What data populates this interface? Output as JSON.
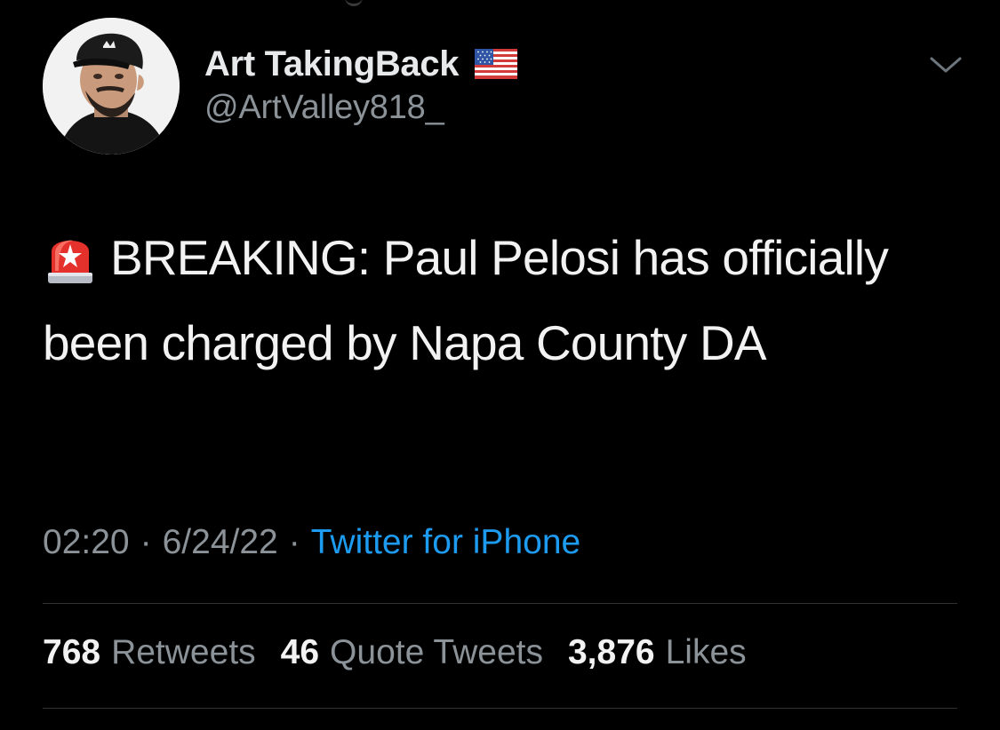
{
  "author": {
    "display_name": "Art TakingBack",
    "handle": "@ArtValley818_",
    "flag_icon": "us-flag-icon",
    "avatar_icon": "profile-avatar"
  },
  "menu": {
    "caret_icon": "chevron-down-icon"
  },
  "tweet": {
    "emoji_icon": "police-siren-icon",
    "text": "BREAKING: Paul Pelosi has officially been charged by Napa County DA"
  },
  "meta": {
    "time": "02:20",
    "date": "6/24/22",
    "separator": "·",
    "source": "Twitter for iPhone"
  },
  "stats": {
    "retweets": {
      "count": "768",
      "label": "Retweets"
    },
    "quote_tweets": {
      "count": "46",
      "label": "Quote Tweets"
    },
    "likes": {
      "count": "3,876",
      "label": "Likes"
    }
  },
  "colors": {
    "background": "#000000",
    "primary_text": "#e7e9ea",
    "secondary_text": "#8b9298",
    "link": "#1d9bf0",
    "divider": "#2f3336"
  }
}
